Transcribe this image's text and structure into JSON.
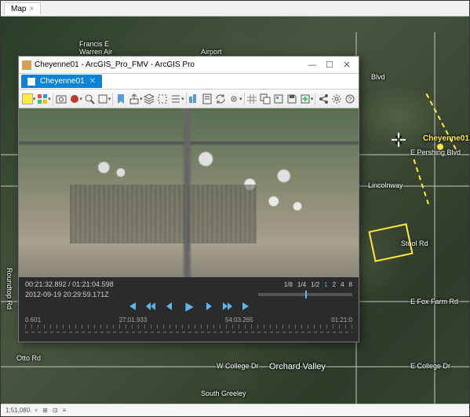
{
  "mapTab": {
    "label": "Map"
  },
  "mapLabels": {
    "francis": "Francis E\nWarren Air",
    "airport": "Airport",
    "blvd": "Blvd",
    "pershing": "E Pershing Blvd",
    "lincolnway": "Lincolnway",
    "stool": "Stool Rd",
    "foxfarm": "E Fox Farm Rd",
    "college": "E College Dr",
    "wcollege": "W College Dr",
    "orchard": "Orchard Valley",
    "sgreeley": "South Greeley",
    "roundtop": "Roundtop Rd",
    "otto": "Otto Rd"
  },
  "marker": {
    "name": "Cheyenne01"
  },
  "fmv": {
    "windowTitle": "Cheyenne01 - ArcGIS_Pro_FMV - ArcGIS Pro",
    "tabName": "Cheyenne01",
    "timecode_current": "00:21:32.892",
    "timecode_total": "01:21:04.598",
    "timestamp": "2012-09-19 20:29:59.171Z",
    "speeds": [
      "1/8",
      "1/4",
      "1/2",
      "1",
      "2",
      "4",
      "8"
    ],
    "speed_selected": "1",
    "tl_start": "0.601",
    "tl_mid1": "27:01.933",
    "tl_mid2": "54:03.265",
    "tl_end": "01:21:0"
  },
  "status": {
    "scale": "1:51,080"
  }
}
